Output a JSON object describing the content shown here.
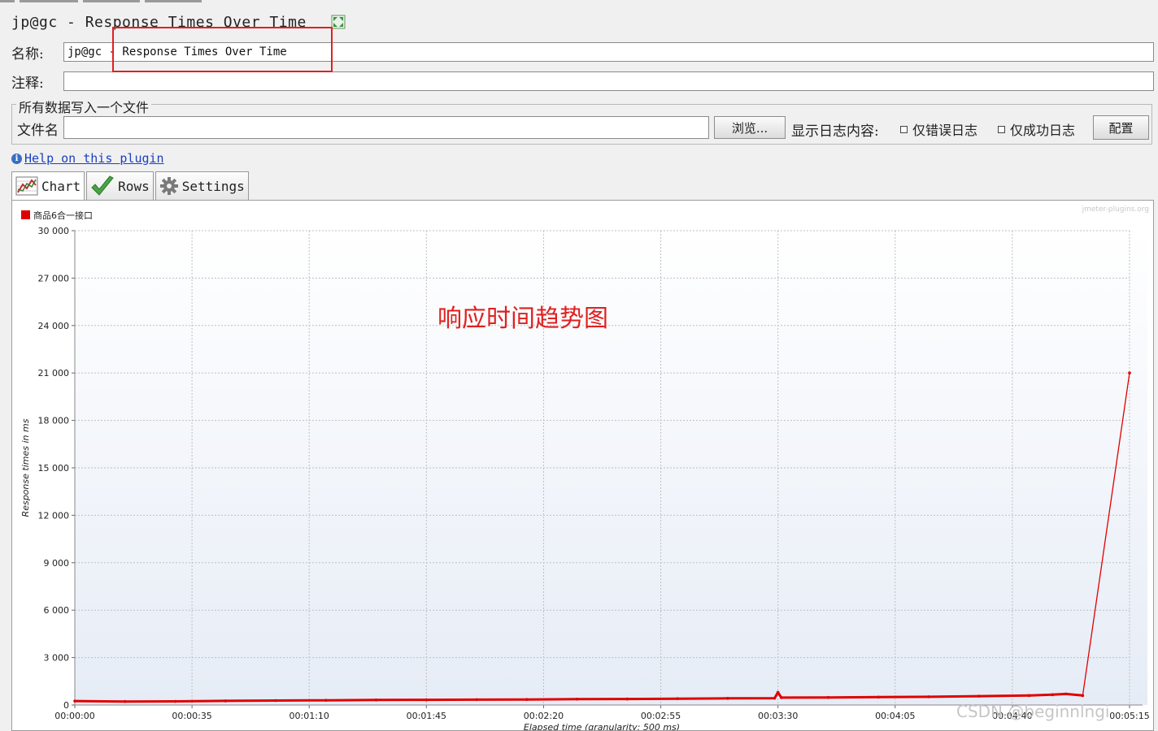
{
  "window": {
    "title": "jp@gc - Response Times Over Time"
  },
  "form": {
    "name_label": "名称:",
    "name_value": "jp@gc - Response Times Over Time",
    "comment_label": "注释:",
    "comment_value": ""
  },
  "file_section": {
    "legend": "所有数据写入一个文件",
    "filename_label": "文件名",
    "filename_value": "",
    "browse_button": "浏览...",
    "log_display_label": "显示日志内容:",
    "errors_only_label": "仅错误日志",
    "success_only_label": "仅成功日志",
    "config_button": "配置"
  },
  "help": {
    "link_text": "Help on this plugin"
  },
  "tabs": [
    {
      "label": "Chart",
      "icon": "chart-icon",
      "active": true
    },
    {
      "label": "Rows",
      "icon": "checkmark-icon",
      "active": false
    },
    {
      "label": "Settings",
      "icon": "gear-icon",
      "active": false
    }
  ],
  "annotation": {
    "text": "响应时间趋势图",
    "color": "#e02020"
  },
  "watermark": {
    "text": "CSDN @beginnlngi"
  },
  "chart_data": {
    "type": "line",
    "brand": "jmeter-plugins.org",
    "legend": [
      {
        "name": "商品6合一接口",
        "color": "#e00000"
      }
    ],
    "legend_position": "top-left",
    "ylabel": "Response times in ms",
    "xlabel": "Elapsed time (granularity: 500 ms)",
    "ylim": [
      0,
      30000
    ],
    "yticks": [
      "0",
      "3 000",
      "6 000",
      "9 000",
      "12 000",
      "15 000",
      "18 000",
      "21 000",
      "24 000",
      "27 000",
      "30 000"
    ],
    "x_unit": "seconds elapsed",
    "xlim": [
      0,
      300
    ],
    "xticks": [
      {
        "t": 0,
        "label": "00:00:00"
      },
      {
        "t": 35,
        "label": "00:00:35"
      },
      {
        "t": 70,
        "label": "00:01:10"
      },
      {
        "t": 105,
        "label": "00:01:45"
      },
      {
        "t": 140,
        "label": "00:02:20"
      },
      {
        "t": 175,
        "label": "00:02:55"
      },
      {
        "t": 210,
        "label": "00:03:30"
      },
      {
        "t": 245,
        "label": "00:04:05"
      },
      {
        "t": 280,
        "label": "00:04:40"
      },
      {
        "t": 315,
        "label": "00:05:15"
      }
    ],
    "grid": true,
    "series": [
      {
        "name": "商品6合一接口",
        "color": "#e00000",
        "x": [
          0,
          15,
          30,
          45,
          60,
          75,
          90,
          105,
          120,
          135,
          150,
          165,
          180,
          195,
          209,
          210,
          211,
          225,
          240,
          255,
          270,
          285,
          292,
          296,
          301,
          315
        ],
        "values": [
          250,
          220,
          230,
          260,
          280,
          300,
          320,
          330,
          340,
          350,
          370,
          380,
          400,
          420,
          430,
          800,
          470,
          480,
          500,
          520,
          560,
          600,
          650,
          700,
          600,
          21000
        ]
      }
    ]
  }
}
